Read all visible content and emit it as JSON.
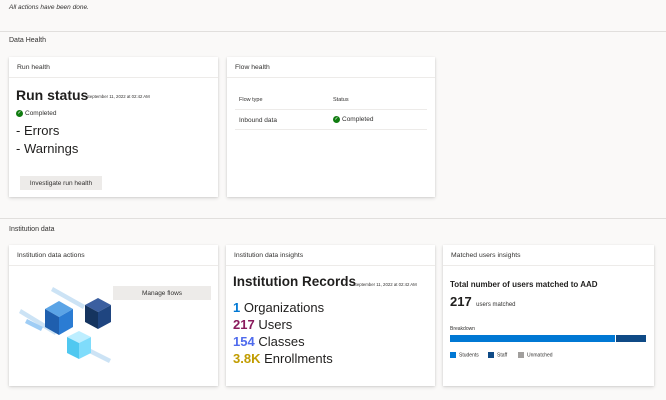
{
  "status_message": "All actions have been done.",
  "data_health": {
    "section_title": "Data Health",
    "run_health": {
      "header": "Run health",
      "title": "Run status",
      "timestamp": "September 11, 2022 at 02:42 AM",
      "status": "Completed",
      "errors_label": "- Errors",
      "warnings_label": "- Warnings",
      "button_label": "Investigate run health"
    },
    "flow_health": {
      "header": "Flow health",
      "columns": [
        "Flow type",
        "Status"
      ],
      "rows": [
        {
          "flow_type": "Inbound data",
          "status": "Completed"
        }
      ]
    }
  },
  "institution_data": {
    "section_title": "Institution data",
    "actions": {
      "header": "Institution data actions",
      "button_label": "Manage flows"
    },
    "insights": {
      "header": "Institution data insights",
      "title": "Institution Records",
      "timestamp": "September 11, 2022 at 02:42 AM",
      "metrics": [
        {
          "value": "1",
          "label": "Organizations",
          "color": "#0078d4"
        },
        {
          "value": "217",
          "label": "Users",
          "color": "#8a1a5c"
        },
        {
          "value": "154",
          "label": "Classes",
          "color": "#4f6bed"
        },
        {
          "value": "3.8K",
          "label": "Enrollments",
          "color": "#c19c00"
        }
      ]
    },
    "matched_users": {
      "header": "Matched users insights",
      "title": "Total number of users matched to AAD",
      "count": "217",
      "count_label": "users matched",
      "breakdown_label": "Breakdown",
      "breakdown": [
        {
          "name": "Students",
          "fraction": 0.844,
          "color": "#0078d4"
        },
        {
          "name": "Staff",
          "fraction": 0.156,
          "color": "#0f4a86"
        },
        {
          "name": "Unmatched",
          "fraction": 0.0,
          "color": "#a19f9d"
        }
      ]
    }
  },
  "icons": [
    "check-circle-icon",
    "cubes-illustration"
  ]
}
